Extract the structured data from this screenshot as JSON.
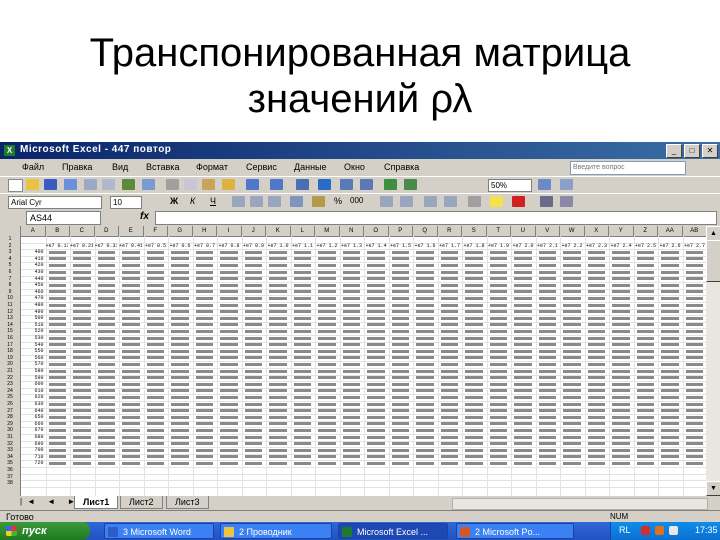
{
  "slide": {
    "title_line1": "Транспонированная матрица",
    "title_line2": "значений ρλ"
  },
  "window": {
    "app_icon": "excel-icon",
    "title": "Microsoft Excel - 447 повтор"
  },
  "menu": {
    "items": [
      "Файл",
      "Правка",
      "Вид",
      "Вставка",
      "Формат",
      "Сервис",
      "Данные",
      "Окно",
      "Справка"
    ],
    "help_placeholder": "Введите вопрос"
  },
  "toolbar": {
    "font": "Arial Cyr",
    "size": "10",
    "zoom": "50%",
    "bold": "Ж",
    "italic": "К",
    "underline": "Ч",
    "currency": "%",
    "thousands": "000"
  },
  "formula_bar": {
    "name_box": "AS44",
    "fx": "fx",
    "value": ""
  },
  "grid": {
    "columns": [
      "A",
      "B",
      "C",
      "D",
      "E",
      "F",
      "G",
      "H",
      "I",
      "J",
      "K",
      "L",
      "M",
      "N",
      "O",
      "P",
      "Q",
      "R",
      "S",
      "T",
      "U",
      "V",
      "W",
      "X",
      "Y",
      "Z",
      "AA",
      "AB"
    ],
    "header_row": [
      "",
      "+e7 0.13",
      "+e7 0.211",
      "+e7 0.31",
      "+e7 0.41",
      "+e7 0.5",
      "+e7 0.6",
      "+e7 0.7",
      "+e7 0.8",
      "+e7 0.9",
      "+e7 1.0",
      "+e7 1.1",
      "+e7 1.2",
      "+e7 1.3",
      "+e7 1.4",
      "+e7 1.5",
      "+e7 1.6",
      "+e7 1.7",
      "+e7 1.8",
      "+e7 1.9",
      "+e7 2.0",
      "+e7 2.1",
      "+e7 2.2",
      "+e7 2.3",
      "+e7 2.4",
      "+e7 2.5",
      "+e7 2.6",
      "+e7 2.7"
    ],
    "first_col": [
      "400",
      "410",
      "420",
      "430",
      "440",
      "450",
      "460",
      "470",
      "480",
      "490",
      "500",
      "510",
      "520",
      "530",
      "540",
      "550",
      "560",
      "570",
      "580",
      "590",
      "600",
      "610",
      "620",
      "630",
      "640",
      "650",
      "660",
      "670",
      "680",
      "690",
      "700",
      "710",
      "720"
    ]
  },
  "sheets": {
    "tabs": [
      "Лист1",
      "Лист2",
      "Лист3"
    ],
    "active": 0,
    "nav": "|◄ ◄ ► ►|"
  },
  "status": {
    "ready": "Готово",
    "num": "NUM"
  },
  "taskbar": {
    "start": "пуск",
    "tasks": [
      {
        "label": "3 Microsoft Word",
        "icon_color": "#2b5cc8"
      },
      {
        "label": "2 Проводник",
        "icon_color": "#e8c442"
      },
      {
        "label": "Microsoft Excel ...",
        "icon_color": "#1d7a2f"
      },
      {
        "label": "2 Microsoft Po...",
        "icon_color": "#d2572a"
      }
    ],
    "active_task": 2,
    "lang": "RL",
    "clock": "17:35"
  }
}
